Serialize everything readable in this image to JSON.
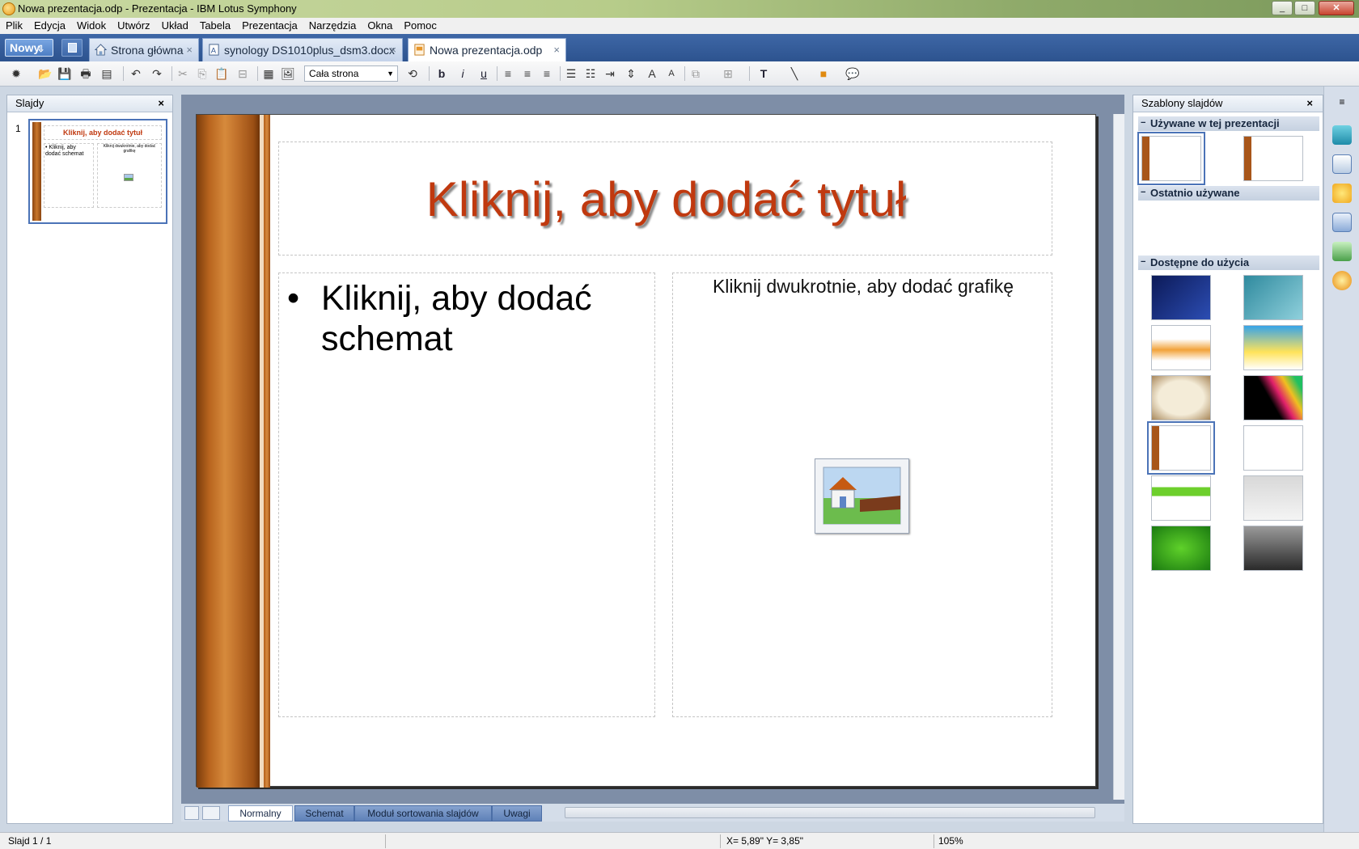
{
  "window": {
    "title": "Nowa prezentacja.odp - Prezentacja - IBM Lotus Symphony",
    "min": "_",
    "max": "□",
    "close": "✕"
  },
  "menu": [
    "Plik",
    "Edycja",
    "Widok",
    "Utwórz",
    "Układ",
    "Tabela",
    "Prezentacja",
    "Narzędzia",
    "Okna",
    "Pomoc"
  ],
  "tabs": {
    "new_label": "Nowy",
    "items": [
      {
        "label": "Strona główna",
        "icon": "home-icon"
      },
      {
        "label": "synology DS1010plus_dsm3.docx",
        "icon": "document-icon"
      },
      {
        "label": "Nowa prezentacja.odp",
        "icon": "presentation-icon"
      }
    ],
    "close": "×"
  },
  "toolbar": {
    "zoom_value": "Cała strona",
    "bold": "b",
    "italic": "i",
    "underline": "u"
  },
  "slides_panel": {
    "title": "Slajdy",
    "close": "×",
    "slide_number": "1",
    "thumb_title": "Kliknij, aby dodać tytuł",
    "thumb_body": "• Kliknij, aby dodać schemat",
    "thumb_pic": "Kliknij dwukrotnie, aby dodać grafikę"
  },
  "slide": {
    "title": "Kliknij, aby dodać tytuł",
    "bullet": "•",
    "body_line1": "Kliknij, aby dodać",
    "body_line2": "schemat",
    "picture_prompt": "Kliknij dwukrotnie, aby dodać grafikę"
  },
  "view_tabs": [
    "Normalny",
    "Schemat",
    "Moduł sortowania slajdów",
    "Uwagi"
  ],
  "templates_panel": {
    "title": "Szablony slajdów",
    "close": "×",
    "sections": [
      "Używane w tej prezentacji",
      "Ostatnio używane",
      "Dostępne do użycia"
    ]
  },
  "status": {
    "slide": "Slajd 1 / 1",
    "coords": "X= 5,89\" Y= 3,85\"",
    "zoom": "105%"
  },
  "colors": {
    "accent": "#2d538f",
    "title_red": "#c0390f",
    "selection": "#4b73b7"
  }
}
